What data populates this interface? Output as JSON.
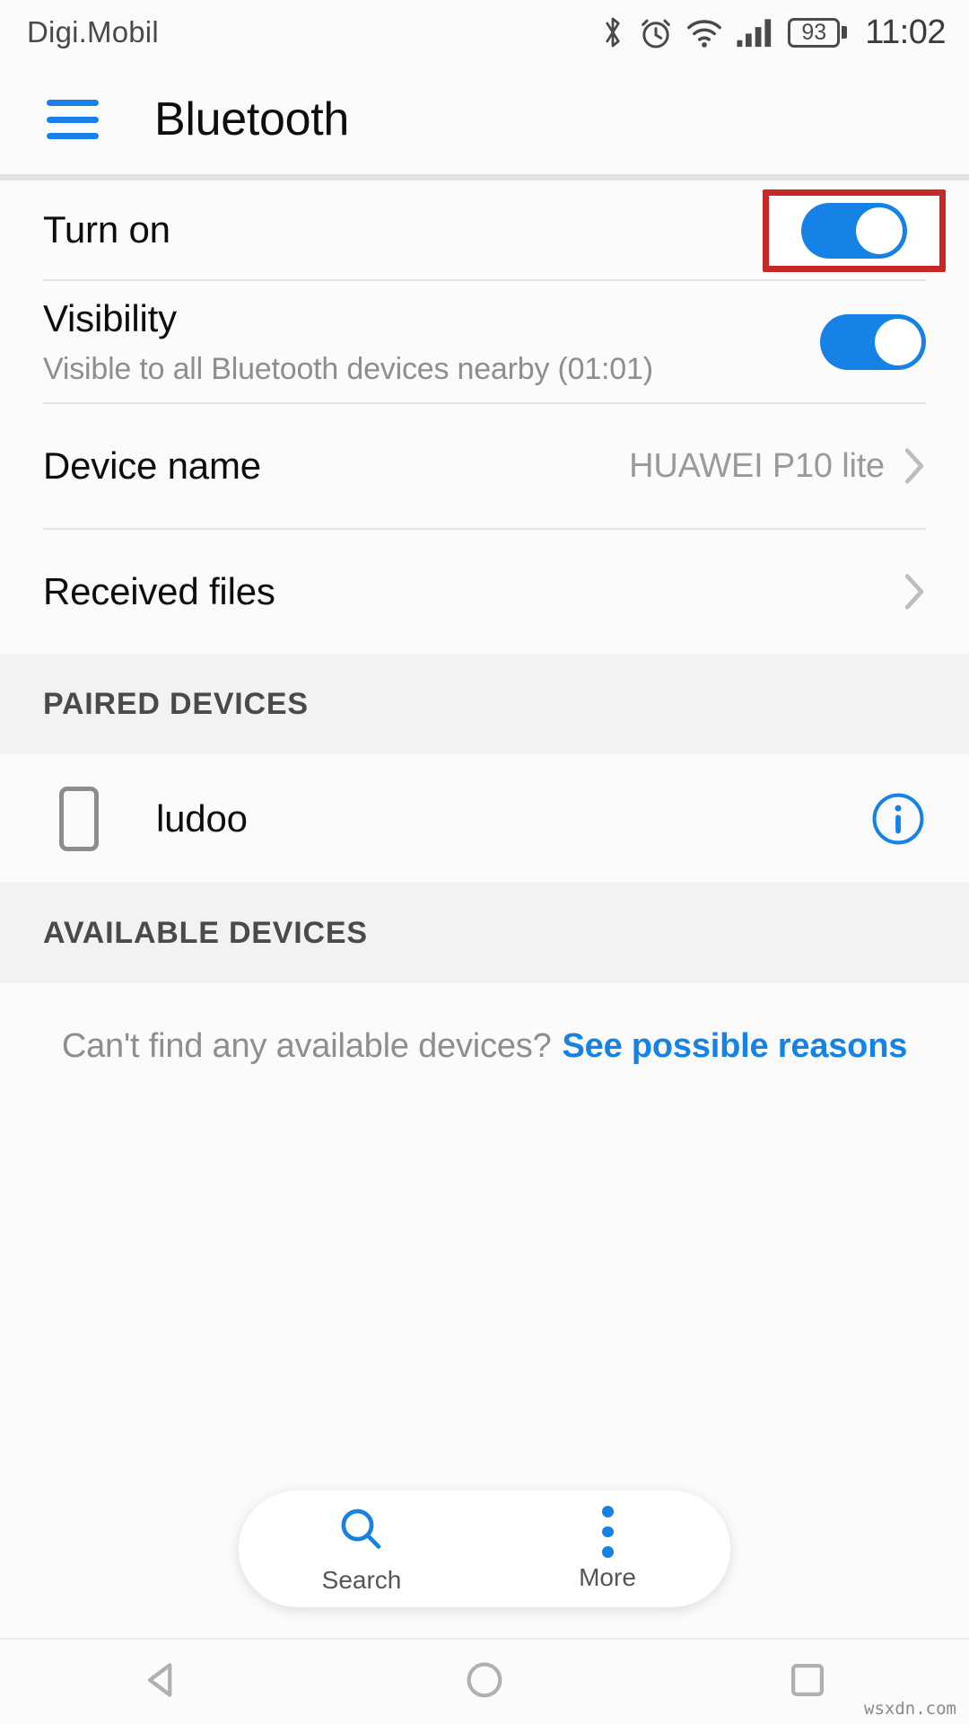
{
  "status_bar": {
    "carrier": "Digi.Mobil",
    "battery_level": "93",
    "time": "11:02",
    "icons": [
      "bluetooth-icon",
      "alarm-icon",
      "wifi-icon",
      "signal-icon",
      "battery-icon"
    ]
  },
  "app_bar": {
    "menu_icon": "hamburger-menu-icon",
    "title": "Bluetooth",
    "accent_color": "#1a7fe8"
  },
  "settings": {
    "turn_on": {
      "label": "Turn on",
      "toggle_state": "on",
      "highlighted": true,
      "highlight_color": "#c62828"
    },
    "visibility": {
      "label": "Visibility",
      "subtitle": "Visible to all Bluetooth devices nearby (01:01)",
      "toggle_state": "on"
    },
    "device_name": {
      "label": "Device name",
      "value": "HUAWEI P10 lite",
      "chevron": "chevron-right-icon"
    },
    "received_files": {
      "label": "Received files",
      "chevron": "chevron-right-icon"
    }
  },
  "paired_section": {
    "header": "PAIRED DEVICES",
    "devices": [
      {
        "name": "ludoo",
        "device_icon": "phone-icon",
        "info_icon": "info-circle-icon"
      }
    ]
  },
  "available_section": {
    "header": "AVAILABLE DEVICES",
    "empty_hint": "Can't find any available devices?",
    "empty_link": "See possible reasons"
  },
  "bottom_bar": {
    "search": {
      "label": "Search",
      "icon": "search-icon"
    },
    "more": {
      "label": "More",
      "icon": "more-vertical-icon"
    }
  },
  "nav_bar": {
    "back": "back-triangle-icon",
    "home": "home-circle-icon",
    "recents": "recents-square-icon"
  },
  "watermark": "wsxdn.com",
  "colors": {
    "accent_blue": "#1682e6",
    "toggle_on": "#1682e6",
    "section_bg": "#f2f2f2",
    "page_bg": "#fbfbfb",
    "highlight_red": "#c62828"
  }
}
